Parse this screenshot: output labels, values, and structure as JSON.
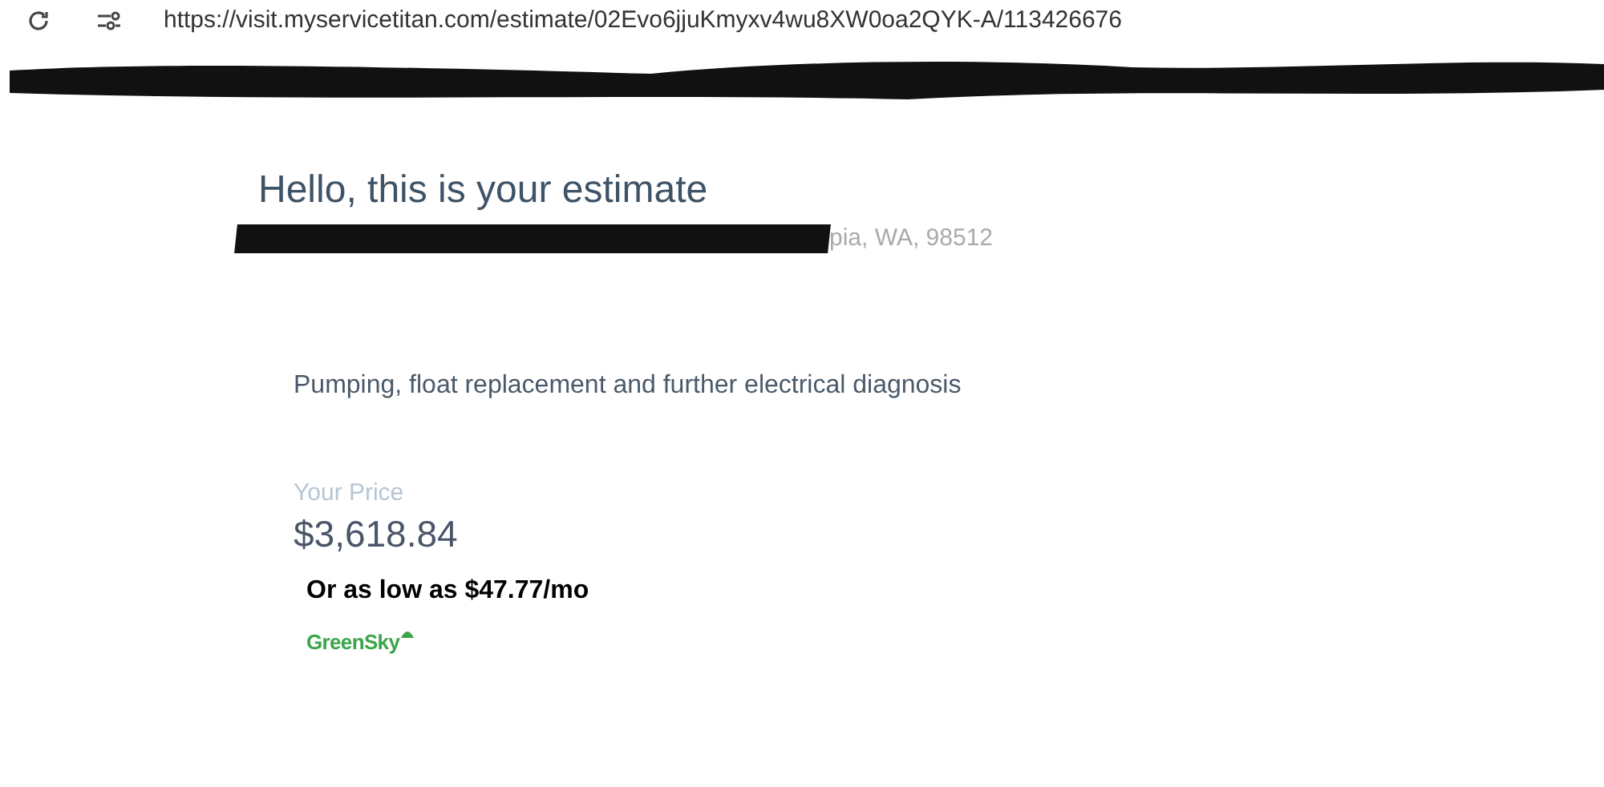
{
  "browser": {
    "url": "https://visit.myservicetitan.com/estimate/02Evo6jjuKmyxv4wu8XW0oa2QYK-A/113426676"
  },
  "estimate": {
    "heading": "Hello, this is your estimate",
    "address": "pia, WA, 98512",
    "description": "Pumping, float replacement and further electrical diagnosis",
    "price_label": "Your Price",
    "price": "$3,618.84",
    "financing": "Or as low as $47.77/mo",
    "lender": "GreenSky"
  }
}
